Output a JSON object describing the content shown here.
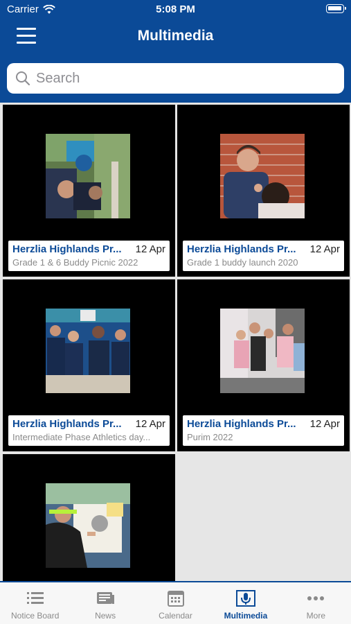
{
  "status_bar": {
    "carrier": "Carrier",
    "time": "5:08 PM"
  },
  "header": {
    "title": "Multimedia"
  },
  "search": {
    "placeholder": "Search"
  },
  "albums": [
    {
      "name": "Herzlia Highlands Pr...",
      "date": "12 Apr",
      "subtitle": "Grade 1 & 6 Buddy Picnic 2022"
    },
    {
      "name": "Herzlia Highlands Pr...",
      "date": "12 Apr",
      "subtitle": "Grade 1 buddy launch 2020"
    },
    {
      "name": "Herzlia Highlands Pr...",
      "date": "12 Apr",
      "subtitle": "Intermediate Phase Athletics day..."
    },
    {
      "name": "Herzlia Highlands Pr...",
      "date": "12 Apr",
      "subtitle": "Purim 2022"
    }
  ],
  "tabs": [
    {
      "label": "Notice Board",
      "icon": "list-icon"
    },
    {
      "label": "News",
      "icon": "newspaper-icon"
    },
    {
      "label": "Calendar",
      "icon": "calendar-icon"
    },
    {
      "label": "Multimedia",
      "icon": "microphone-icon"
    },
    {
      "label": "More",
      "icon": "more-dots-icon"
    }
  ],
  "colors": {
    "accent": "#0b4a97",
    "tab_inactive": "#8a8a8a"
  }
}
